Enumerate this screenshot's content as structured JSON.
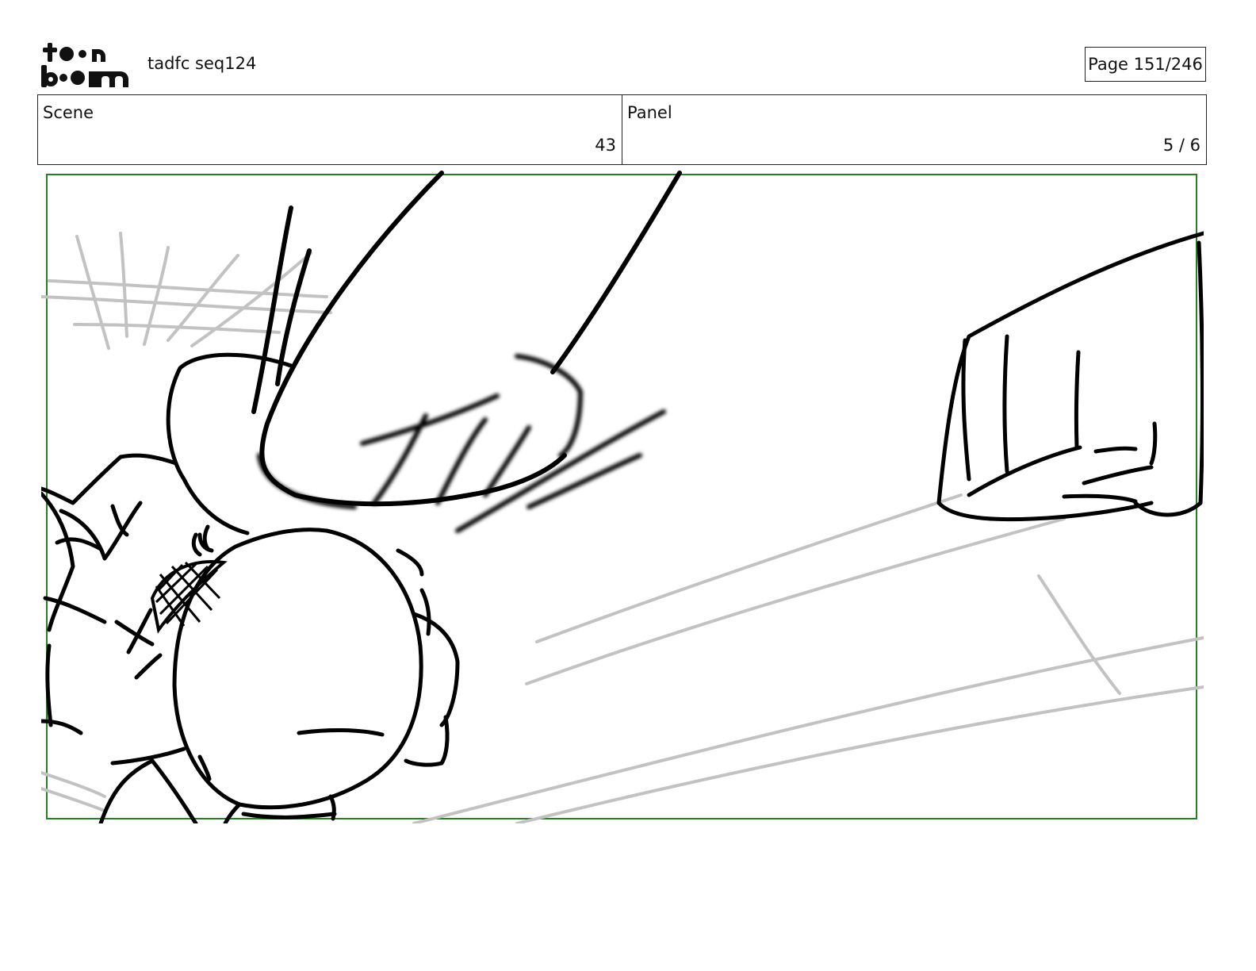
{
  "header": {
    "logo": {
      "icon": "toonboom-logo",
      "text_line1": "toon",
      "text_line2": "boom"
    },
    "document_title": "tadfc seq124",
    "page_indicator": "Page 151/246"
  },
  "info": {
    "scene_label": "Scene",
    "scene_value": "43",
    "panel_label": "Panel",
    "panel_value": "5 / 6"
  },
  "panel": {
    "frame_color": "#2d7a2d",
    "line_color": "#000000",
    "guide_color": "#c0c0c0"
  }
}
